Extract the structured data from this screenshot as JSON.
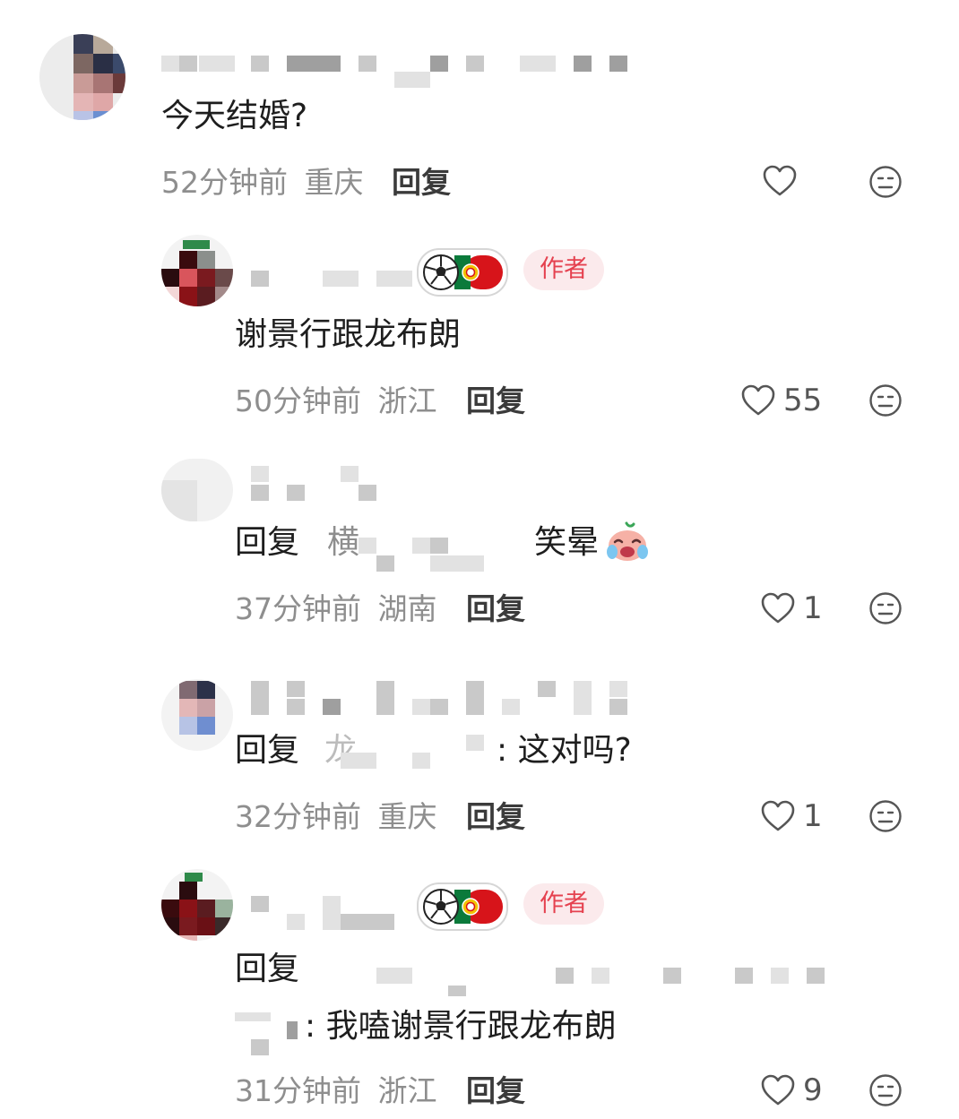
{
  "comments": [
    {
      "text": "今天结婚?",
      "time": "52分钟前",
      "location": "重庆",
      "reply_label": "回复",
      "likes": ""
    },
    {
      "is_author": true,
      "author_badge": "作者",
      "text": "谢景行跟龙布朗",
      "time": "50分钟前",
      "location": "浙江",
      "reply_label": "回复",
      "likes": "55"
    },
    {
      "reply_prefix": "回复",
      "reply_to_fragment": "横",
      "text": "笑晕",
      "emoji": "crying-laughing-face",
      "time": "37分钟前",
      "location": "湖南",
      "reply_label": "回复",
      "likes": "1"
    },
    {
      "reply_prefix": "回复",
      "reply_to_fragment": "龙",
      "text": ":  这对吗?",
      "time": "32分钟前",
      "location": "重庆",
      "reply_label": "回复",
      "likes": "1"
    },
    {
      "is_author": true,
      "author_badge": "作者",
      "reply_prefix": "回复",
      "text": ":  我嗑谢景行跟龙布朗",
      "time": "31分钟前",
      "location": "浙江",
      "reply_label": "回复",
      "likes": "9"
    }
  ],
  "icons": {
    "like": "heart-outline-icon",
    "dislike": "neutral-face-icon",
    "medal": "football-portugal-medal"
  },
  "colors": {
    "author_badge_bg": "#fbeaec",
    "author_badge_text": "#e5414f",
    "meta_text": "#8e8e8e"
  }
}
